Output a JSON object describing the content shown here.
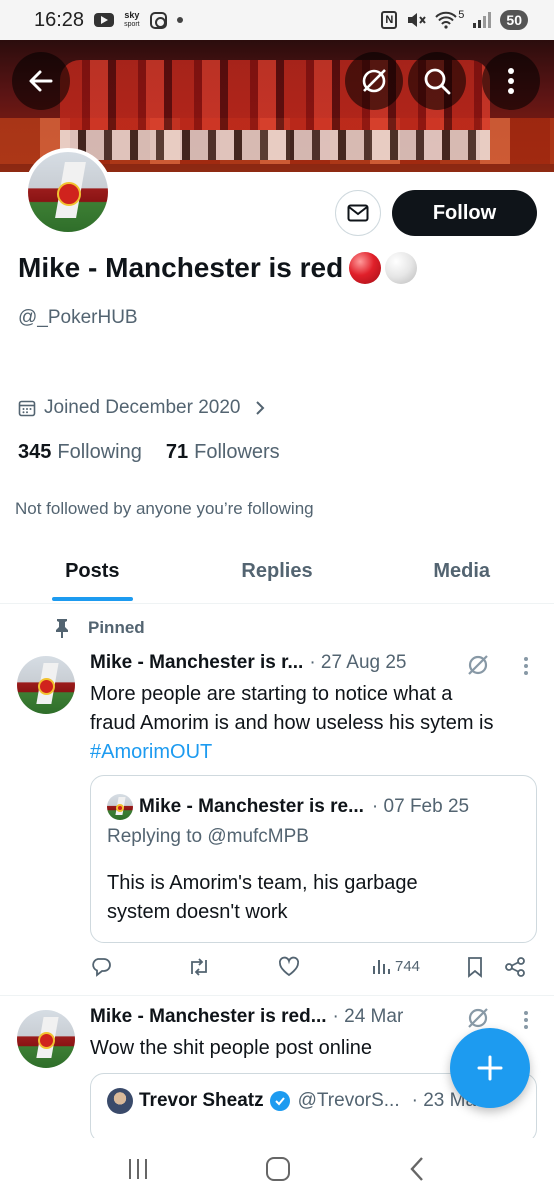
{
  "status_bar": {
    "time": "16:28",
    "sky_label_top": "sky",
    "sky_label_bottom": "sport",
    "nfc": "N",
    "network": "5",
    "battery": "50"
  },
  "profile": {
    "display_name": "Mike - Manchester is red",
    "handle": "@_PokerHUB",
    "joined": "Joined December 2020",
    "following_count": "345",
    "following_label": "Following",
    "followers_count": "71",
    "followers_label": "Followers",
    "not_followed_text": "Not followed by anyone you’re following",
    "follow_button": "Follow"
  },
  "tabs": [
    {
      "label": "Posts",
      "active": true
    },
    {
      "label": "Replies",
      "active": false
    },
    {
      "label": "Media",
      "active": false
    }
  ],
  "posts": [
    {
      "pinned_label": "Pinned",
      "author": "Mike - Manchester is r...",
      "meta": "· 27 Aug 25",
      "text_line1": "More people are starting to notice what a",
      "text_line2": "fraud Amorim is and how useless his sytem is",
      "hashtag": "#AmorimOUT",
      "quote": {
        "author": "Mike - Manchester is re...",
        "meta": "· 07 Feb 25",
        "reply_to": "Replying to @mufcMPB",
        "text_line1": "This is Amorim's team, his garbage",
        "text_line2": "system doesn't work"
      },
      "views": "744"
    },
    {
      "author": "Mike - Manchester is red...",
      "meta": "· 24 Mar",
      "text": "Wow the shit people post online",
      "quote": {
        "author": "Trevor Sheatz",
        "handle": "@TrevorS...",
        "meta": "· 23 Mar"
      }
    }
  ],
  "colors": {
    "accent": "#1d9bf0",
    "text": "#0f1419",
    "secondary": "#536471"
  }
}
